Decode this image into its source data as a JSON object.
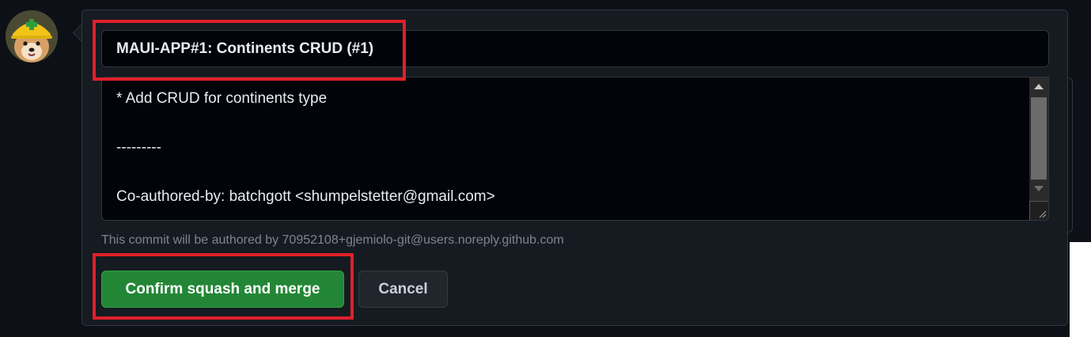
{
  "commit": {
    "title_value": "MAUI-APP#1: Continents CRUD (#1)",
    "message_lines": [
      "* Add CRUD for continents type",
      "",
      "---------",
      "",
      "Co-authored-by: batchgott <shumpelstetter@gmail.com>"
    ],
    "author_note": "This commit will be authored by 70952108+gjemiolo-git@users.noreply.github.com"
  },
  "buttons": {
    "confirm_label": "Confirm squash and merge",
    "cancel_label": "Cancel"
  },
  "icons": {
    "avatar": "shiba-dog-hardhat-avatar",
    "scroll_up": "arrow-up-icon",
    "scroll_down": "arrow-down-icon",
    "resize": "resize-grip-icon"
  },
  "colors": {
    "background": "#0d1117",
    "panel": "#161b22",
    "input_bg": "#010409",
    "confirm_green": "#238636",
    "highlight_red": "#e0202a"
  }
}
